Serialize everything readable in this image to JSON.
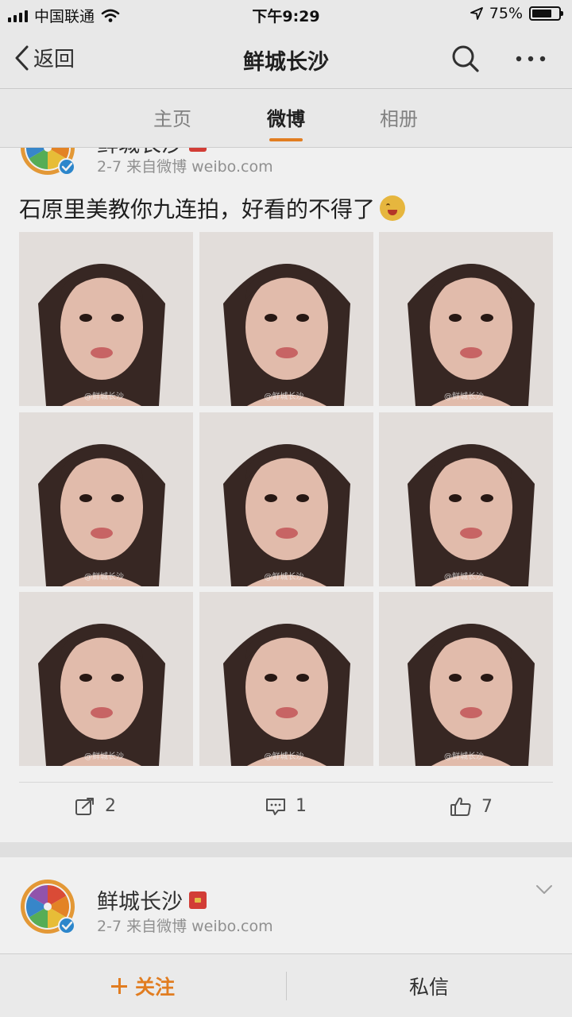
{
  "status_bar": {
    "carrier": "中国联通",
    "time": "下午9:29",
    "battery_text": "75%",
    "battery_level": 0.75
  },
  "nav": {
    "back_label": "返回",
    "title": "鲜城长沙",
    "icons": [
      "chevron-left-icon",
      "search-icon",
      "more-icon"
    ]
  },
  "tabs": [
    {
      "label": "主页",
      "active": false
    },
    {
      "label": "微博",
      "active": true
    },
    {
      "label": "相册",
      "active": false
    }
  ],
  "accent_color": "#f08524",
  "posts": [
    {
      "username": "鲜城长沙",
      "meta": "2-7  来自微博 weibo.com",
      "text": "石原里美教你九连拍，好看的不得了",
      "image_count": 9,
      "watermark": "@鲜城长沙",
      "actions": {
        "repost": "2",
        "comment": "1",
        "like": "7"
      }
    },
    {
      "username": "鲜城长沙",
      "meta": "2-7  来自微博 weibo.com"
    }
  ],
  "bottom_bar": {
    "follow_label": "关注",
    "message_label": "私信"
  }
}
